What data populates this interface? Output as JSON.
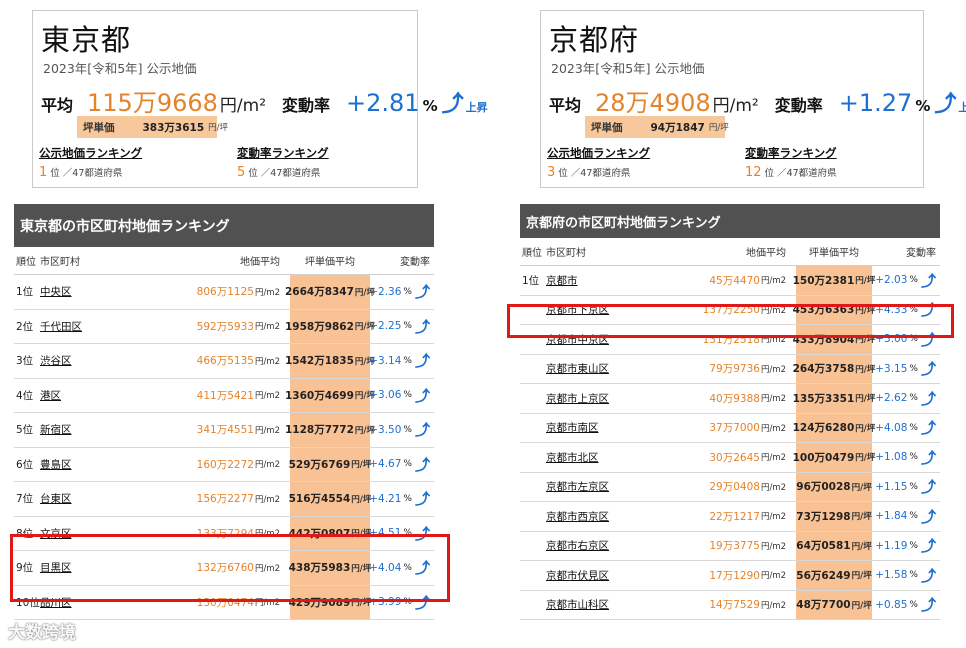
{
  "tokyo_card": {
    "pref": "東京都",
    "subtitle": "2023年[令和5年] 公示地価",
    "avg_label": "平均",
    "avg_value": "115万9668",
    "avg_unit": "円/m²",
    "rate_label": "変動率",
    "rate_value": "+2.81",
    "rate_pct": "%",
    "rate_dir": "上昇",
    "tsubo_label": "坪単価",
    "tsubo_value": "383万3615",
    "tsubo_unit": "円/坪",
    "rank1_title": "公示地価ランキング",
    "rank1_num": "1",
    "rank1_suffix": "位 ／47都道府県",
    "rank2_title": "変動率ランキング",
    "rank2_num": "5",
    "rank2_suffix": "位 ／47都道府県"
  },
  "kyoto_card": {
    "pref": "京都府",
    "subtitle": "2023年[令和5年] 公示地価",
    "avg_label": "平均",
    "avg_value": "28万4908",
    "avg_unit": "円/m²",
    "rate_label": "変動率",
    "rate_value": "+1.27",
    "rate_pct": "%",
    "rate_dir": "上昇",
    "tsubo_label": "坪単価",
    "tsubo_value": "94万1847",
    "tsubo_unit": "円/坪",
    "rank1_title": "公示地価ランキング",
    "rank1_num": "3",
    "rank1_suffix": "位 ／47都道府県",
    "rank2_title": "変動率ランキング",
    "rank2_num": "12",
    "rank2_suffix": "位 ／47都道府県"
  },
  "tokyo_table": {
    "title": "東京都の市区町村地価ランキング",
    "headers": {
      "rank": "順位",
      "name": "市区町村",
      "price": "地価平均",
      "tsubo": "坪単価平均",
      "change": "変動率"
    },
    "price_unit": "円/m2",
    "tsubo_unit": "円/坪",
    "pct": "%",
    "rows": [
      {
        "rank": "1位",
        "name": "中央区",
        "price": "806万1125",
        "tsubo": "2664万8347",
        "change": "+2.36"
      },
      {
        "rank": "2位",
        "name": "千代田区",
        "price": "592万5933",
        "tsubo": "1958万9862",
        "change": "+2.25"
      },
      {
        "rank": "3位",
        "name": "渋谷区",
        "price": "466万5135",
        "tsubo": "1542万1835",
        "change": "+3.14"
      },
      {
        "rank": "4位",
        "name": "港区",
        "price": "411万5421",
        "tsubo": "1360万4699",
        "change": "+3.06"
      },
      {
        "rank": "5位",
        "name": "新宿区",
        "price": "341万4551",
        "tsubo": "1128万7772",
        "change": "+3.50"
      },
      {
        "rank": "6位",
        "name": "豊島区",
        "price": "160万2272",
        "tsubo": "529万6769",
        "change": "+4.67"
      },
      {
        "rank": "7位",
        "name": "台東区",
        "price": "156万2277",
        "tsubo": "516万4554",
        "change": "+4.21"
      },
      {
        "rank": "8位",
        "name": "文京区",
        "price": "133万7294",
        "tsubo": "442万0807",
        "change": "+4.51"
      },
      {
        "rank": "9位",
        "name": "目黒区",
        "price": "132万6760",
        "tsubo": "438万5983",
        "change": "+4.04"
      },
      {
        "rank": "10位",
        "name": "品川区",
        "price": "130万0474",
        "tsubo": "429万9089",
        "change": "+3.99"
      }
    ]
  },
  "kyoto_table": {
    "title": "京都府の市区町村地価ランキング",
    "headers": {
      "rank": "順位",
      "name": "市区町村",
      "price": "地価平均",
      "tsubo": "坪単価平均",
      "change": "変動率"
    },
    "price_unit": "円/m2",
    "tsubo_unit": "円/坪",
    "pct": "%",
    "rows": [
      {
        "rank": "1位",
        "name": "京都市",
        "price": "45万4470",
        "tsubo": "150万2381",
        "change": "+2.03"
      },
      {
        "rank": "",
        "name": "京都市下京区",
        "price": "137万2250",
        "tsubo": "453万6363",
        "change": "+4.33"
      },
      {
        "rank": "",
        "name": "京都市中京区",
        "price": "131万2518",
        "tsubo": "433万8904",
        "change": "+3.00"
      },
      {
        "rank": "",
        "name": "京都市東山区",
        "price": "79万9736",
        "tsubo": "264万3758",
        "change": "+3.15"
      },
      {
        "rank": "",
        "name": "京都市上京区",
        "price": "40万9388",
        "tsubo": "135万3351",
        "change": "+2.62"
      },
      {
        "rank": "",
        "name": "京都市南区",
        "price": "37万7000",
        "tsubo": "124万6280",
        "change": "+4.08"
      },
      {
        "rank": "",
        "name": "京都市北区",
        "price": "30万2645",
        "tsubo": "100万0479",
        "change": "+1.08"
      },
      {
        "rank": "",
        "name": "京都市左京区",
        "price": "29万0408",
        "tsubo": "96万0028",
        "change": "+1.15"
      },
      {
        "rank": "",
        "name": "京都市西京区",
        "price": "22万1217",
        "tsubo": "73万1298",
        "change": "+1.84"
      },
      {
        "rank": "",
        "name": "京都市右京区",
        "price": "19万3775",
        "tsubo": "64万0581",
        "change": "+1.19"
      },
      {
        "rank": "",
        "name": "京都市伏見区",
        "price": "17万1290",
        "tsubo": "56万6249",
        "change": "+1.58"
      },
      {
        "rank": "",
        "name": "京都市山科区",
        "price": "14万7529",
        "tsubo": "48万7700",
        "change": "+0.85"
      }
    ]
  },
  "watermark": "大数跨境",
  "colors": {
    "orange": "#e5832a",
    "blue": "#1f6fd0",
    "tsubo_bg": "#f8c295",
    "header_bar": "#515151",
    "highlight": "#e01818"
  }
}
